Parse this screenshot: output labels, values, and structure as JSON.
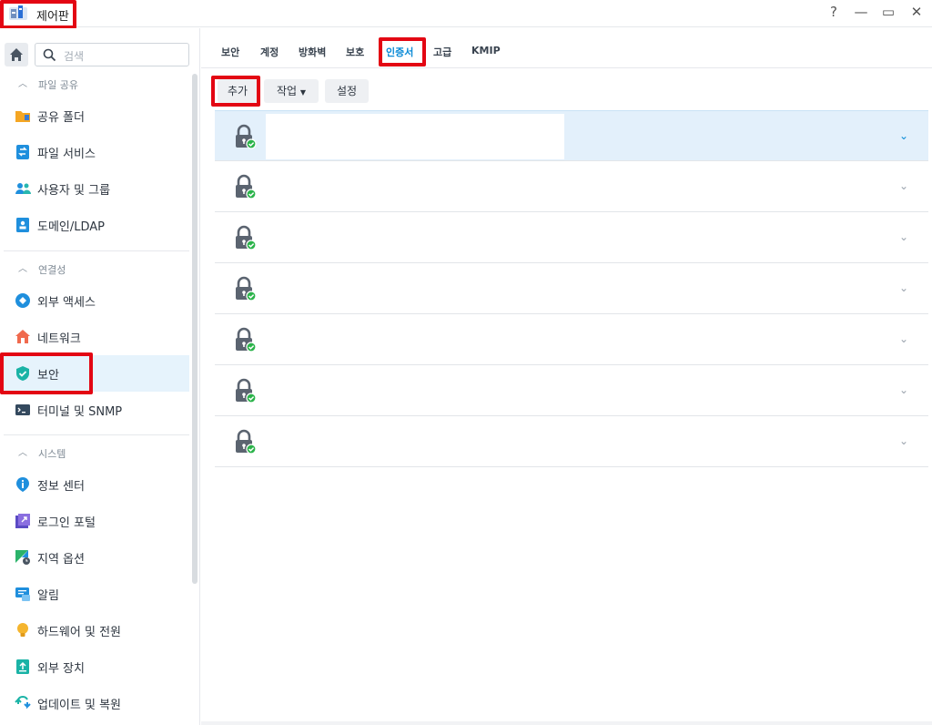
{
  "window": {
    "title": "제어판",
    "controls": {
      "help": "?",
      "minimize": "—",
      "maximize": "▭",
      "close": "✕"
    }
  },
  "sidebar": {
    "search_placeholder": "검색",
    "sections": [
      {
        "label": "파일 공유",
        "items": [
          "공유 폴더",
          "파일 서비스",
          "사용자 및 그룹",
          "도메인/LDAP"
        ]
      },
      {
        "label": "연결성",
        "items": [
          "외부 액세스",
          "네트워크",
          "보안",
          "터미널 및 SNMP"
        ]
      },
      {
        "label": "시스템",
        "items": [
          "정보 센터",
          "로그인 포털",
          "지역 옵션",
          "알림",
          "하드웨어 및 전원",
          "외부 장치",
          "업데이트 및 복원"
        ]
      }
    ],
    "active_item": "보안"
  },
  "tabs": [
    "보안",
    "계정",
    "방화벽",
    "보호",
    "인증서",
    "고급",
    "KMIP"
  ],
  "active_tab": "인증서",
  "toolbar": {
    "add": "추가",
    "action": "작업",
    "settings": "설정"
  },
  "certificates": {
    "row_count": 7,
    "expanded_first": true
  },
  "colors": {
    "accent": "#0a8ad6",
    "highlight": "#e30613",
    "active_bg": "#e6f3fc"
  }
}
